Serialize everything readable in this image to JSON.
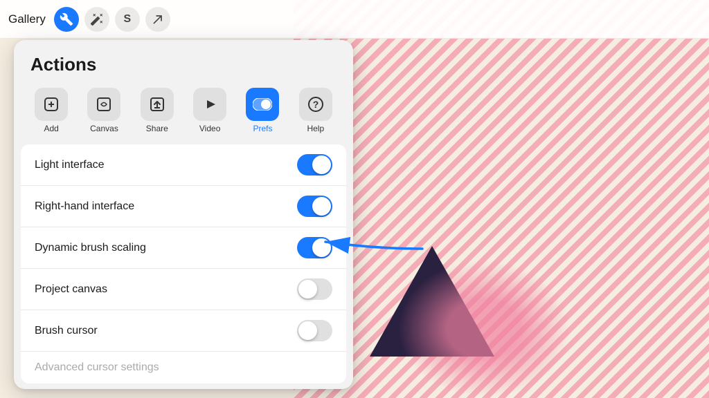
{
  "app": {
    "title": "Gallery"
  },
  "toolbar": {
    "gallery_label": "Gallery",
    "buttons": [
      {
        "id": "wrench",
        "icon": "🔧",
        "active": true,
        "label": "wrench"
      },
      {
        "id": "magic",
        "icon": "✨",
        "active": false,
        "label": "magic"
      },
      {
        "id": "transform",
        "icon": "S",
        "active": false,
        "label": "transform"
      },
      {
        "id": "export",
        "icon": "↗",
        "active": false,
        "label": "export"
      }
    ]
  },
  "panel": {
    "title": "Actions",
    "actions": [
      {
        "id": "add",
        "icon": "+",
        "label": "Add",
        "active": false
      },
      {
        "id": "canvas",
        "icon": "◎",
        "label": "Canvas",
        "active": false
      },
      {
        "id": "share",
        "icon": "↑",
        "label": "Share",
        "active": false
      },
      {
        "id": "video",
        "icon": "▶",
        "label": "Video",
        "active": false
      },
      {
        "id": "prefs",
        "icon": "⏺",
        "label": "Prefs",
        "active": true
      },
      {
        "id": "help",
        "icon": "?",
        "label": "Help",
        "active": false
      }
    ],
    "toggles": [
      {
        "id": "light-interface",
        "label": "Light interface",
        "on": true,
        "dimmed": false
      },
      {
        "id": "right-hand",
        "label": "Right-hand interface",
        "on": true,
        "dimmed": false
      },
      {
        "id": "dynamic-brush",
        "label": "Dynamic brush scaling",
        "on": true,
        "dimmed": false
      },
      {
        "id": "project-canvas",
        "label": "Project canvas",
        "on": false,
        "dimmed": false
      },
      {
        "id": "brush-cursor",
        "label": "Brush cursor",
        "on": false,
        "dimmed": false
      },
      {
        "id": "advanced-cursor",
        "label": "Advanced cursor settings",
        "on": null,
        "dimmed": true
      }
    ]
  }
}
